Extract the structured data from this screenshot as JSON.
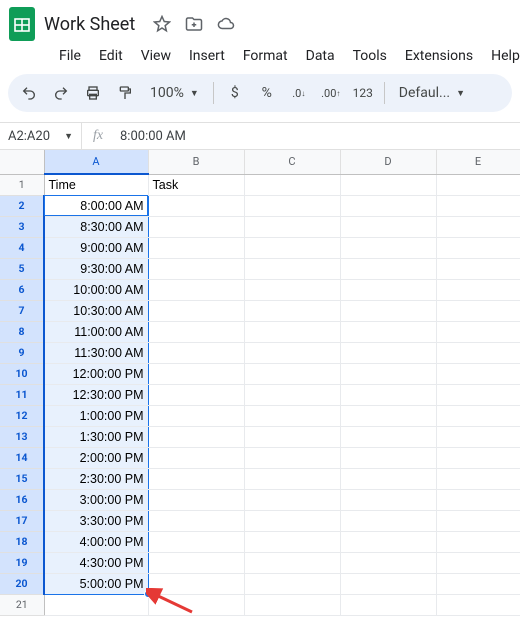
{
  "doc": {
    "title": "Work Sheet"
  },
  "menu": {
    "file": "File",
    "edit": "Edit",
    "view": "View",
    "insert": "Insert",
    "format": "Format",
    "data": "Data",
    "tools": "Tools",
    "extensions": "Extensions",
    "help": "Help"
  },
  "toolbar": {
    "zoom": "100%",
    "currency": "$",
    "percent": "%",
    "dec_dec": ".0",
    "dec_inc": ".00",
    "numfmt": "123",
    "font": "Defaul..."
  },
  "namebox": {
    "ref": "A2:A20",
    "formula": "8:00:00 AM"
  },
  "columns": [
    "A",
    "B",
    "C",
    "D",
    "E"
  ],
  "headers": {
    "a1": "Time",
    "b1": "Task"
  },
  "rows": [
    {
      "n": 1,
      "a": "Time",
      "b": "Task",
      "head": true
    },
    {
      "n": 2,
      "a": "8:00:00 AM"
    },
    {
      "n": 3,
      "a": "8:30:00 AM"
    },
    {
      "n": 4,
      "a": "9:00:00 AM"
    },
    {
      "n": 5,
      "a": "9:30:00 AM"
    },
    {
      "n": 6,
      "a": "10:00:00 AM"
    },
    {
      "n": 7,
      "a": "10:30:00 AM"
    },
    {
      "n": 8,
      "a": "11:00:00 AM"
    },
    {
      "n": 9,
      "a": "11:30:00 AM"
    },
    {
      "n": 10,
      "a": "12:00:00 PM"
    },
    {
      "n": 11,
      "a": "12:30:00 PM"
    },
    {
      "n": 12,
      "a": "1:00:00 PM"
    },
    {
      "n": 13,
      "a": "1:30:00 PM"
    },
    {
      "n": 14,
      "a": "2:00:00 PM"
    },
    {
      "n": 15,
      "a": "2:30:00 PM"
    },
    {
      "n": 16,
      "a": "3:00:00 PM"
    },
    {
      "n": 17,
      "a": "3:30:00 PM"
    },
    {
      "n": 18,
      "a": "4:00:00 PM"
    },
    {
      "n": 19,
      "a": "4:30:00 PM"
    },
    {
      "n": 20,
      "a": "5:00:00 PM"
    },
    {
      "n": 21,
      "a": ""
    }
  ]
}
